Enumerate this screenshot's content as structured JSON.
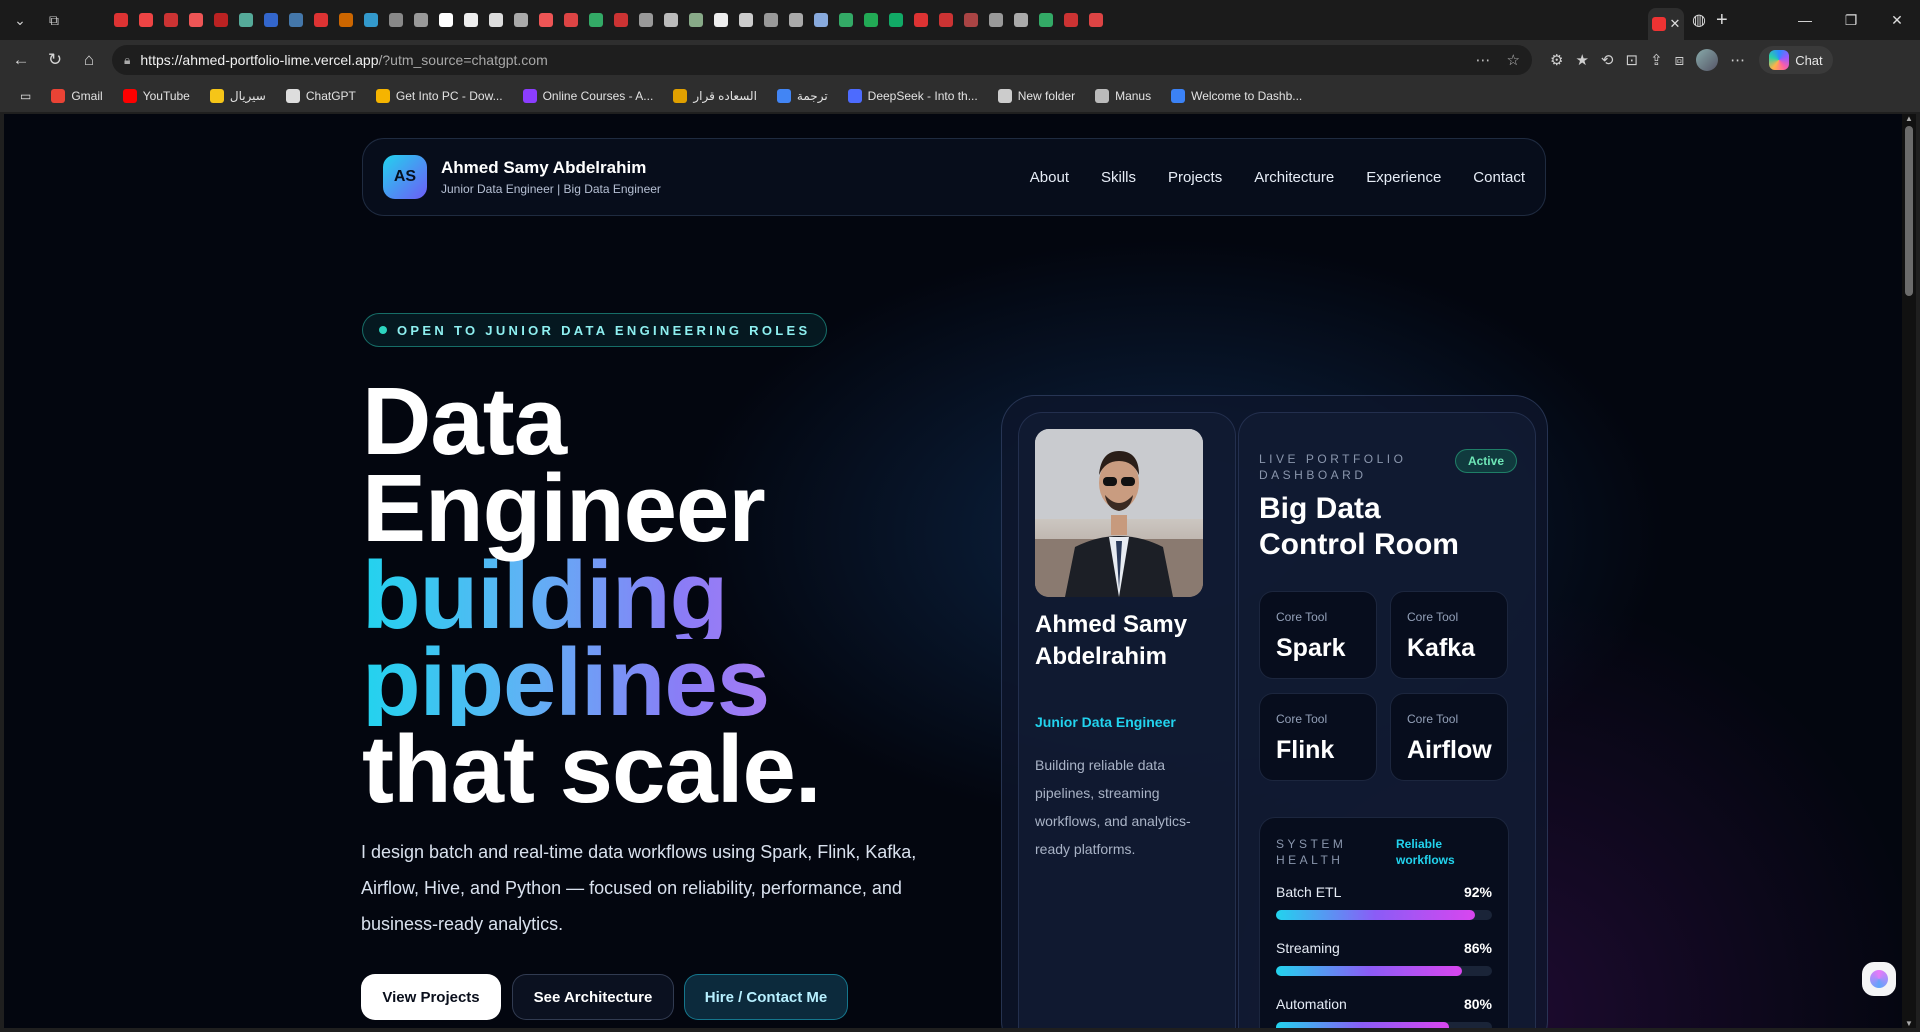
{
  "browser": {
    "url_host": "https://ahmed-portfolio-lime.vercel.app",
    "url_rest": "/?utm_source=chatgpt.com",
    "chat_label": "Chat",
    "bookmarks": [
      {
        "label": "Gmail",
        "color": "#ea4335"
      },
      {
        "label": "YouTube",
        "color": "#ff0000"
      },
      {
        "label": "سيريال",
        "color": "#f5c518"
      },
      {
        "label": "ChatGPT",
        "color": "#dddddd"
      },
      {
        "label": "Get Into PC - Dow...",
        "color": "#f5b400"
      },
      {
        "label": "Online Courses - A...",
        "color": "#8b3dff"
      },
      {
        "label": "السعاده قرار",
        "color": "#e0a000"
      },
      {
        "label": "ترجمة",
        "color": "#4285f4"
      },
      {
        "label": "DeepSeek - Into th...",
        "color": "#4d6bfe"
      },
      {
        "label": "New folder",
        "color": "#cccccc"
      },
      {
        "label": "Manus",
        "color": "#bbbbbb"
      },
      {
        "label": "Welcome to Dashb...",
        "color": "#3b82f6"
      }
    ],
    "tab_favicon_colors": [
      "#d33",
      "#e44",
      "#c33",
      "#e55",
      "#b22",
      "#5a9",
      "#36c",
      "#47a",
      "#d33",
      "#c60",
      "#39c",
      "#888",
      "#999",
      "#fff",
      "#eee",
      "#ddd",
      "#aaa",
      "#e55",
      "#d44",
      "#3a6",
      "#c33",
      "#999",
      "#bbb",
      "#8a8",
      "#eee",
      "#ccc",
      "#999",
      "#aaa",
      "#8ad",
      "#3a6",
      "#2a5",
      "#1a6",
      "#d33",
      "#c33",
      "#a44",
      "#999",
      "#aaa",
      "#3a6",
      "#c33",
      "#d44"
    ]
  },
  "site": {
    "logo_initials": "AS",
    "brand_name": "Ahmed Samy Abdelrahim",
    "brand_sub": "Junior Data Engineer | Big Data Engineer",
    "nav": [
      "About",
      "Skills",
      "Projects",
      "Architecture",
      "Experience",
      "Contact"
    ]
  },
  "hero": {
    "badge": "OPEN TO JUNIOR DATA ENGINEERING ROLES",
    "title_lines": [
      "Data",
      "Engineer",
      "building",
      "pipelines",
      "that scale."
    ],
    "description": "I design batch and real-time data workflows using Spark, Flink, Kafka, Airflow, Hive, and Python — focused on reliability, performance, and business-ready analytics.",
    "buttons": {
      "primary": "View Projects",
      "secondary": "See Architecture",
      "tertiary": "Hire / Contact Me"
    }
  },
  "dashboard": {
    "profile": {
      "name": "Ahmed Samy Abdelrahim",
      "role": "Junior Data Engineer",
      "bio": "Building reliable data pipelines, streaming workflows, and analytics-ready platforms."
    },
    "live_label": "LIVE PORTFOLIO DASHBOARD",
    "status": "Active",
    "title": "Big Data Control Room",
    "tools": [
      {
        "label": "Core Tool",
        "name": "Spark"
      },
      {
        "label": "Core Tool",
        "name": "Kafka"
      },
      {
        "label": "Core Tool",
        "name": "Flink"
      },
      {
        "label": "Core Tool",
        "name": "Airflow"
      }
    ],
    "health": {
      "label": "SYSTEM HEALTH",
      "tag": "Reliable workflows",
      "metrics": [
        {
          "name": "Batch ETL",
          "value": "92%",
          "percent": 92
        },
        {
          "name": "Streaming",
          "value": "86%",
          "percent": 86
        },
        {
          "name": "Automation",
          "value": "80%",
          "percent": 80
        }
      ]
    }
  }
}
